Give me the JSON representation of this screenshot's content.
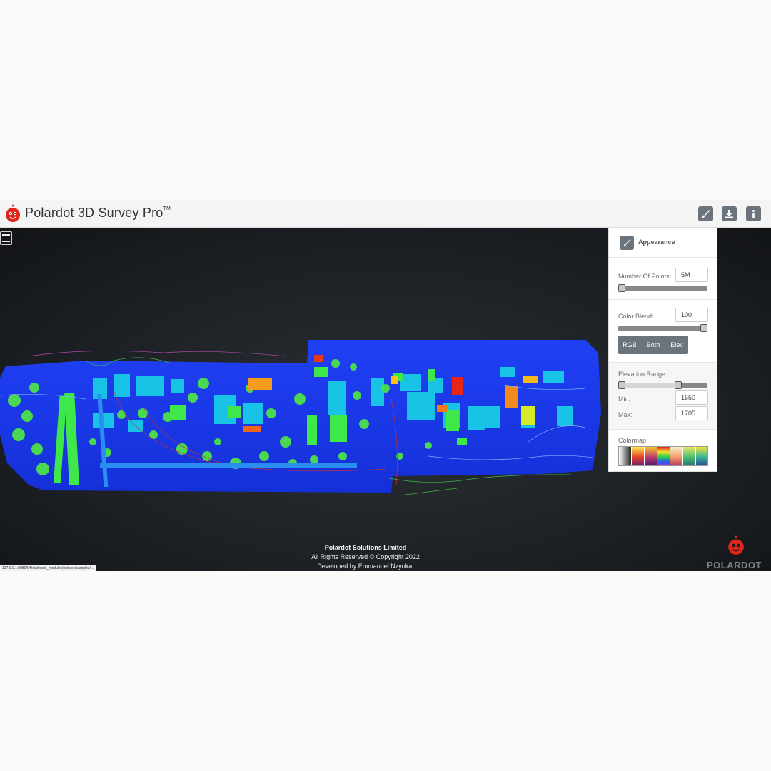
{
  "app": {
    "title": "Polardot 3D Survey Pro",
    "trademark": "TM"
  },
  "toolbar": {
    "buttons": [
      {
        "name": "appearance",
        "icon": "paintbrush-icon"
      },
      {
        "name": "download",
        "icon": "download-icon"
      },
      {
        "name": "info",
        "icon": "info-icon"
      }
    ]
  },
  "panel": {
    "header": "Appearance",
    "points": {
      "label": "Number Of Points:",
      "value": "5M",
      "fraction": 0.0
    },
    "blend": {
      "label": "Color Blend:",
      "value": "100",
      "fraction": 1.0
    },
    "modes": [
      "RGB",
      "Both",
      "Elev"
    ],
    "elevation": {
      "label": "Elevation Range:",
      "min_label": "Min:",
      "min_value": "1650",
      "max_label": "Max:",
      "max_value": "1705",
      "low_fraction": 0.0,
      "high_fraction": 0.69
    },
    "colormap": {
      "label": "Colormap:",
      "count": 7
    }
  },
  "footer": {
    "company": "Polardot Solutions Limited",
    "rights": "All Rights Reserved © Copyright 2022",
    "developer": "Developed by Emmanuel Nzyoka."
  },
  "status_url": "127.0.0.1:8080/Official/node_modules/potree/examples/...",
  "brand": "POLARDOT",
  "colors": {
    "accent": "#6b737c",
    "logo_red": "#e1251b",
    "cloud_blue": "#1a3cf0",
    "cloud_cyan": "#18c8e8",
    "cloud_green": "#3fe84a"
  }
}
